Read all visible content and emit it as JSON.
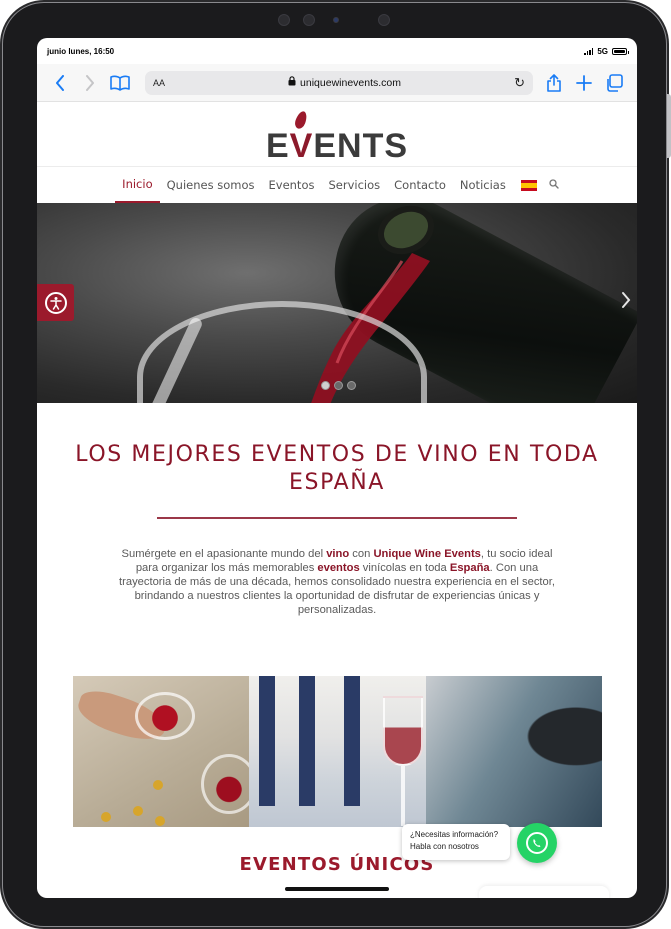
{
  "status": {
    "time": "junio lunes, 16:50",
    "network": "5G"
  },
  "safari": {
    "text_size_label": "AA",
    "url": "uniquewinevents.com"
  },
  "site": {
    "logo": {
      "first": "E",
      "middle": "V",
      "rest": "ENTS"
    },
    "nav": [
      {
        "label": "Inicio",
        "active": true
      },
      {
        "label": "Quienes somos"
      },
      {
        "label": "Eventos"
      },
      {
        "label": "Servicios"
      },
      {
        "label": "Contacto"
      },
      {
        "label": "Noticias"
      }
    ],
    "language_flag": "es-flag",
    "hero": {
      "slides": 3,
      "active_slide": 1
    },
    "intro": {
      "title": "LOS MEJORES EVENTOS DE VINO EN TODA ESPAÑA",
      "p1": "Sumérgete en el apasionante mundo del ",
      "k_vino": "vino",
      "p2": " con ",
      "k_brand": "Unique Wine Events",
      "p3": ", tu socio ideal para organizar los más memorables ",
      "k_eventos": "eventos",
      "p4": " vinícolas en toda ",
      "k_espana": "España",
      "p5": ". Con una trayectoria de más de una década, hemos consolidado nuestra experiencia en el sector, brindando a nuestros clientes la oportunidad de disfrutar de experiencias únicas y personalizadas."
    },
    "section_title": "EVENTOS ÚNICOS",
    "chat": {
      "line1": "¿Necesitas información?",
      "line2": "Habla con nosotros"
    }
  },
  "colors": {
    "brand": "#9b1a2c",
    "ios_blue": "#1a7cf5",
    "whatsapp": "#25d366"
  }
}
